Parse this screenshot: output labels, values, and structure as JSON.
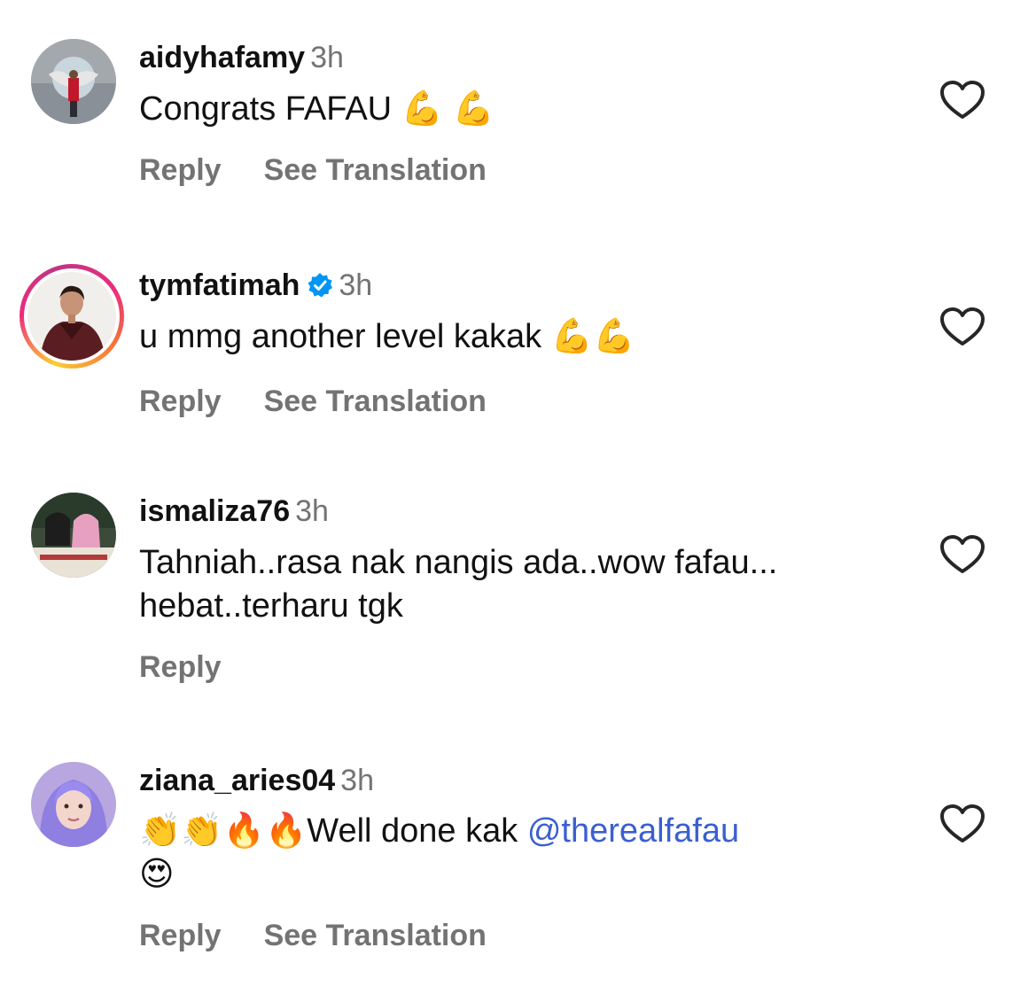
{
  "comments": [
    {
      "username": "aidyhafamy",
      "time": "3h",
      "text": "Congrats FAFAU 💪 💪",
      "reply_label": "Reply",
      "translate_label": "See Translation"
    },
    {
      "username": "tymfatimah",
      "time": "3h",
      "text": "u mmg another level kakak 💪💪",
      "reply_label": "Reply",
      "translate_label": "See Translation"
    },
    {
      "username": "ismaliza76",
      "time": "3h",
      "text_line1": "Tahniah..rasa nak nangis ada..wow fafau...",
      "text_line2": "hebat..terharu tgk",
      "reply_label": "Reply"
    },
    {
      "username": "ziana_aries04",
      "time": "3h",
      "text_prefix": "👏👏🔥🔥Well done kak ",
      "mention": "@therealfafau",
      "text_line2": "😍",
      "reply_label": "Reply",
      "translate_label": "See Translation"
    }
  ],
  "colors": {
    "text": "#111111",
    "meta": "#737373",
    "mention": "#3b5fd0",
    "verified": "#0095f6"
  },
  "icons": [
    "heart-outline-icon",
    "verified-badge-icon"
  ]
}
